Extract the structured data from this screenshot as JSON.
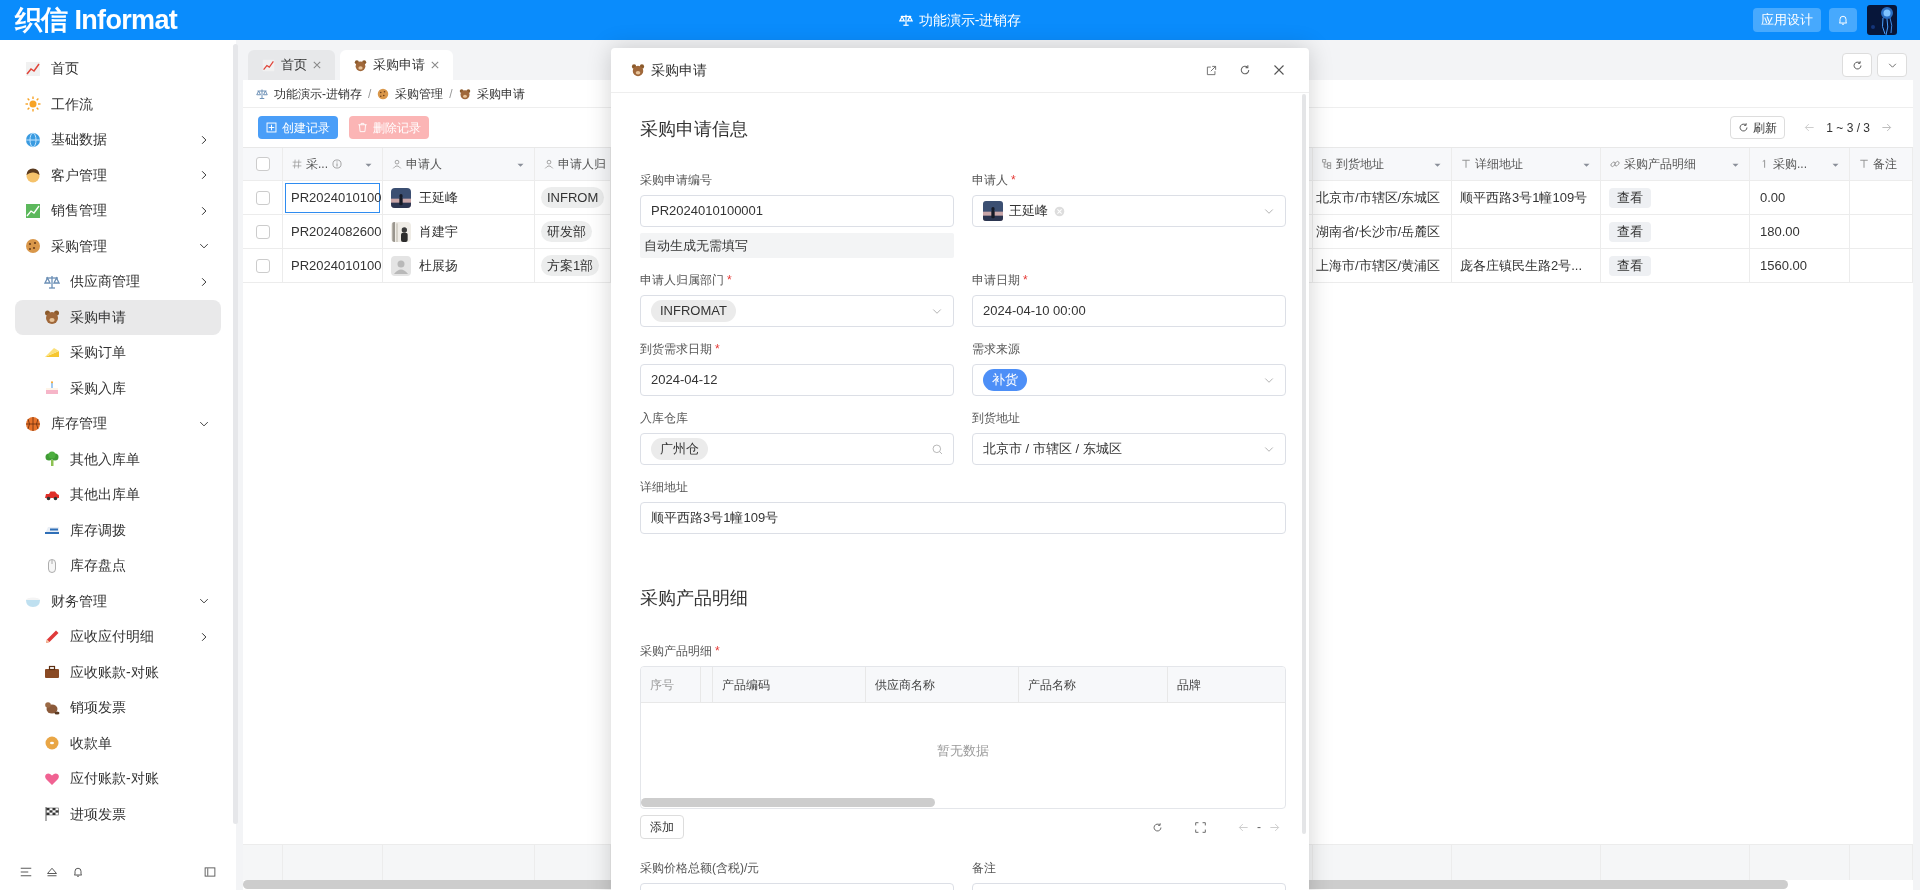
{
  "topbar": {
    "logo": "织信 Informat",
    "app_title": "功能演示-进销存",
    "design_button": "应用设计"
  },
  "sidebar": {
    "items": [
      {
        "label": "首页",
        "selected": false
      },
      {
        "label": "工作流",
        "selected": false
      },
      {
        "label": "基础数据",
        "selected": false,
        "expanded": false
      },
      {
        "label": "客户管理",
        "selected": false,
        "expanded": false
      },
      {
        "label": "销售管理",
        "selected": false,
        "expanded": false
      },
      {
        "label": "采购管理",
        "selected": false,
        "expanded": true,
        "children": [
          {
            "label": "供应商管理",
            "selected": false,
            "expanded": false
          },
          {
            "label": "采购申请",
            "selected": true
          },
          {
            "label": "采购订单",
            "selected": false
          },
          {
            "label": "采购入库",
            "selected": false
          }
        ]
      },
      {
        "label": "库存管理",
        "selected": false,
        "expanded": true,
        "children": [
          {
            "label": "其他入库单",
            "selected": false
          },
          {
            "label": "其他出库单",
            "selected": false
          },
          {
            "label": "库存调拨",
            "selected": false
          },
          {
            "label": "库存盘点",
            "selected": false
          }
        ]
      },
      {
        "label": "财务管理",
        "selected": false,
        "expanded": true,
        "children": [
          {
            "label": "应收应付明细",
            "selected": false,
            "expanded": false
          },
          {
            "label": "应收账款-对账",
            "selected": false
          },
          {
            "label": "销项发票",
            "selected": false
          },
          {
            "label": "收款单",
            "selected": false
          },
          {
            "label": "应付账款-对账",
            "selected": false
          },
          {
            "label": "进项发票",
            "selected": false
          }
        ]
      }
    ]
  },
  "tabs": [
    {
      "label": "首页",
      "selected": false
    },
    {
      "label": "采购申请",
      "selected": true
    }
  ],
  "breadcrumb": [
    "功能演示-进销存",
    "采购管理",
    "采购申请"
  ],
  "breadcrumb_separator": "/",
  "toolbar": {
    "create_button": "创建记录",
    "delete_button": "删除记录",
    "delete_disabled": true,
    "refresh_button": "刷新",
    "pagination": "1 ~ 3 / 3"
  },
  "table": {
    "all_checked": false,
    "columns_left": [
      "采...",
      "申请人",
      "申请人归"
    ],
    "columns_right": [
      "到货地址",
      "详细地址",
      "采购产品明细",
      "采购...",
      "备注"
    ],
    "rows": [
      {
        "checked": false,
        "focused": true,
        "number": "PR2024010100",
        "applicant": "王延峰",
        "photo": true,
        "department": "INFROM",
        "address": "北京市/市辖区/东城区",
        "detail": "顺平西路3号1幢109号",
        "items_button": "查看",
        "amount": "0.00"
      },
      {
        "checked": false,
        "focused": false,
        "number": "PR2024082600",
        "applicant": "肖建宇",
        "photo": true,
        "department": "研发部",
        "address": "湖南省/长沙市/岳麓区",
        "items_button": "查看",
        "amount": "180.00"
      },
      {
        "checked": false,
        "focused": false,
        "number": "PR2024010100",
        "applicant": "杜展扬",
        "photo": false,
        "department": "方案1部",
        "address": "上海市/市辖区/黄浦区",
        "detail": "庞各庄镇民生路2号...",
        "items_button": "查看",
        "amount": "1560.00"
      }
    ]
  },
  "dialog": {
    "title": "采购申请",
    "section_title": "采购申请信息",
    "required_mark": "*",
    "fields": [
      {
        "kind": "text",
        "label": "采购申请编号",
        "required": false,
        "value": "PR2024010100001",
        "note": "自动生成无需填写"
      },
      {
        "kind": "user",
        "label": "申请人",
        "required": true,
        "value": "王延峰"
      },
      {
        "kind": "tag_select",
        "label": "申请人归属部门",
        "required": true,
        "value": "INFROMAT"
      },
      {
        "kind": "text",
        "label": "申请日期",
        "required": true,
        "value": "2024-04-10 00:00"
      },
      {
        "kind": "text",
        "label": "到货需求日期",
        "required": true,
        "value": "2024-04-12"
      },
      {
        "kind": "option_select",
        "label": "需求来源",
        "required": false,
        "value": "补货"
      },
      {
        "kind": "tag_search",
        "label": "入库仓库",
        "required": false,
        "value": "广州仓"
      },
      {
        "kind": "select",
        "label": "到货地址",
        "required": false,
        "value": "北京市 / 市辖区 / 东城区"
      },
      {
        "kind": "wide_text",
        "label": "详细地址",
        "required": false,
        "value": "顺平西路3号1幢109号"
      }
    ],
    "detail_section": {
      "title": "采购产品明细",
      "label": "采购产品明细",
      "required": true,
      "columns": [
        "序号",
        "产品编码",
        "供应商名称",
        "产品名称",
        "品牌"
      ],
      "empty_text": "暂无数据",
      "add_button": "添加",
      "pager": "-"
    },
    "bottom_fields": [
      {
        "label": "采购价格总额(含税)/元",
        "required": false
      },
      {
        "label": "备注",
        "required": false
      }
    ]
  }
}
